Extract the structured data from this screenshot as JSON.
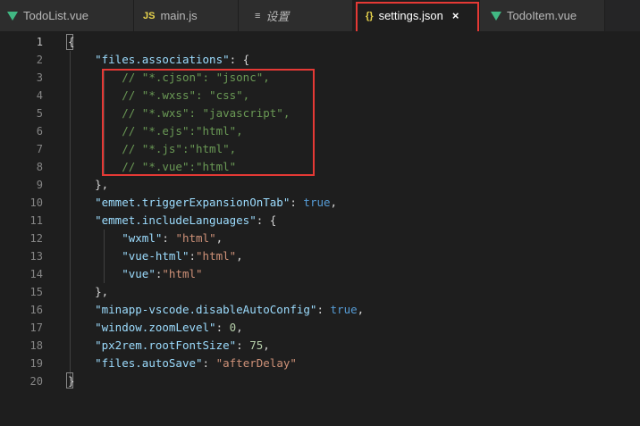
{
  "tabs": [
    {
      "label": "TodoList.vue",
      "icon": "vue-icon"
    },
    {
      "label": "main.js",
      "icon": "js-icon",
      "icon_text": "JS"
    },
    {
      "label": "设置",
      "icon": "settings-list-icon",
      "icon_text": "≡"
    },
    {
      "label": "settings.json",
      "icon": "json-icon",
      "icon_text": "{}",
      "active": true,
      "close": "×"
    },
    {
      "label": "TodoItem.vue",
      "icon": "vue-icon"
    }
  ],
  "editor": {
    "line_numbers": [
      "1",
      "2",
      "3",
      "4",
      "5",
      "6",
      "7",
      "8",
      "9",
      "10",
      "11",
      "12",
      "13",
      "14",
      "15",
      "16",
      "17",
      "18",
      "19",
      "20"
    ],
    "lines": [
      [
        {
          "t": "{",
          "c": "p"
        }
      ],
      [
        {
          "t": "    ",
          "c": "p"
        },
        {
          "t": "\"files.associations\"",
          "c": "k"
        },
        {
          "t": ": {",
          "c": "p"
        }
      ],
      [
        {
          "t": "        ",
          "c": "p"
        },
        {
          "t": "// \"*.cjson\": \"jsonc\",",
          "c": "c"
        }
      ],
      [
        {
          "t": "        ",
          "c": "p"
        },
        {
          "t": "// \"*.wxss\": \"css\",",
          "c": "c"
        }
      ],
      [
        {
          "t": "        ",
          "c": "p"
        },
        {
          "t": "// \"*.wxs\": \"javascript\",",
          "c": "c"
        }
      ],
      [
        {
          "t": "        ",
          "c": "p"
        },
        {
          "t": "// \"*.ejs\":\"html\",",
          "c": "c"
        }
      ],
      [
        {
          "t": "        ",
          "c": "p"
        },
        {
          "t": "// \"*.js\":\"html\",",
          "c": "c"
        }
      ],
      [
        {
          "t": "        ",
          "c": "p"
        },
        {
          "t": "// \"*.vue\":\"html\"",
          "c": "c"
        }
      ],
      [
        {
          "t": "    },",
          "c": "p"
        }
      ],
      [
        {
          "t": "    ",
          "c": "p"
        },
        {
          "t": "\"emmet.triggerExpansionOnTab\"",
          "c": "k"
        },
        {
          "t": ": ",
          "c": "p"
        },
        {
          "t": "true",
          "c": "b"
        },
        {
          "t": ",",
          "c": "p"
        }
      ],
      [
        {
          "t": "    ",
          "c": "p"
        },
        {
          "t": "\"emmet.includeLanguages\"",
          "c": "k"
        },
        {
          "t": ": {",
          "c": "p"
        }
      ],
      [
        {
          "t": "        ",
          "c": "p"
        },
        {
          "t": "\"wxml\"",
          "c": "k"
        },
        {
          "t": ": ",
          "c": "p"
        },
        {
          "t": "\"html\"",
          "c": "s"
        },
        {
          "t": ",",
          "c": "p"
        }
      ],
      [
        {
          "t": "        ",
          "c": "p"
        },
        {
          "t": "\"vue-html\"",
          "c": "k"
        },
        {
          "t": ":",
          "c": "p"
        },
        {
          "t": "\"html\"",
          "c": "s"
        },
        {
          "t": ",",
          "c": "p"
        }
      ],
      [
        {
          "t": "        ",
          "c": "p"
        },
        {
          "t": "\"vue\"",
          "c": "k"
        },
        {
          "t": ":",
          "c": "p"
        },
        {
          "t": "\"html\"",
          "c": "s"
        }
      ],
      [
        {
          "t": "    },",
          "c": "p"
        }
      ],
      [
        {
          "t": "    ",
          "c": "p"
        },
        {
          "t": "\"minapp-vscode.disableAutoConfig\"",
          "c": "k"
        },
        {
          "t": ": ",
          "c": "p"
        },
        {
          "t": "true",
          "c": "b"
        },
        {
          "t": ",",
          "c": "p"
        }
      ],
      [
        {
          "t": "    ",
          "c": "p"
        },
        {
          "t": "\"window.zoomLevel\"",
          "c": "k"
        },
        {
          "t": ": ",
          "c": "p"
        },
        {
          "t": "0",
          "c": "n"
        },
        {
          "t": ",",
          "c": "p"
        }
      ],
      [
        {
          "t": "    ",
          "c": "p"
        },
        {
          "t": "\"px2rem.rootFontSize\"",
          "c": "k"
        },
        {
          "t": ": ",
          "c": "p"
        },
        {
          "t": "75",
          "c": "n"
        },
        {
          "t": ",",
          "c": "p"
        }
      ],
      [
        {
          "t": "    ",
          "c": "p"
        },
        {
          "t": "\"files.autoSave\"",
          "c": "k"
        },
        {
          "t": ": ",
          "c": "p"
        },
        {
          "t": "\"afterDelay\"",
          "c": "s"
        }
      ],
      [
        {
          "t": "}",
          "c": "p"
        }
      ]
    ]
  },
  "colors": {
    "highlight": "#e53935",
    "vue": "#41b883",
    "key": "#9cdcfe",
    "string": "#ce9178",
    "comment": "#6a9955",
    "bool": "#569cd6",
    "number": "#b5cea8"
  }
}
